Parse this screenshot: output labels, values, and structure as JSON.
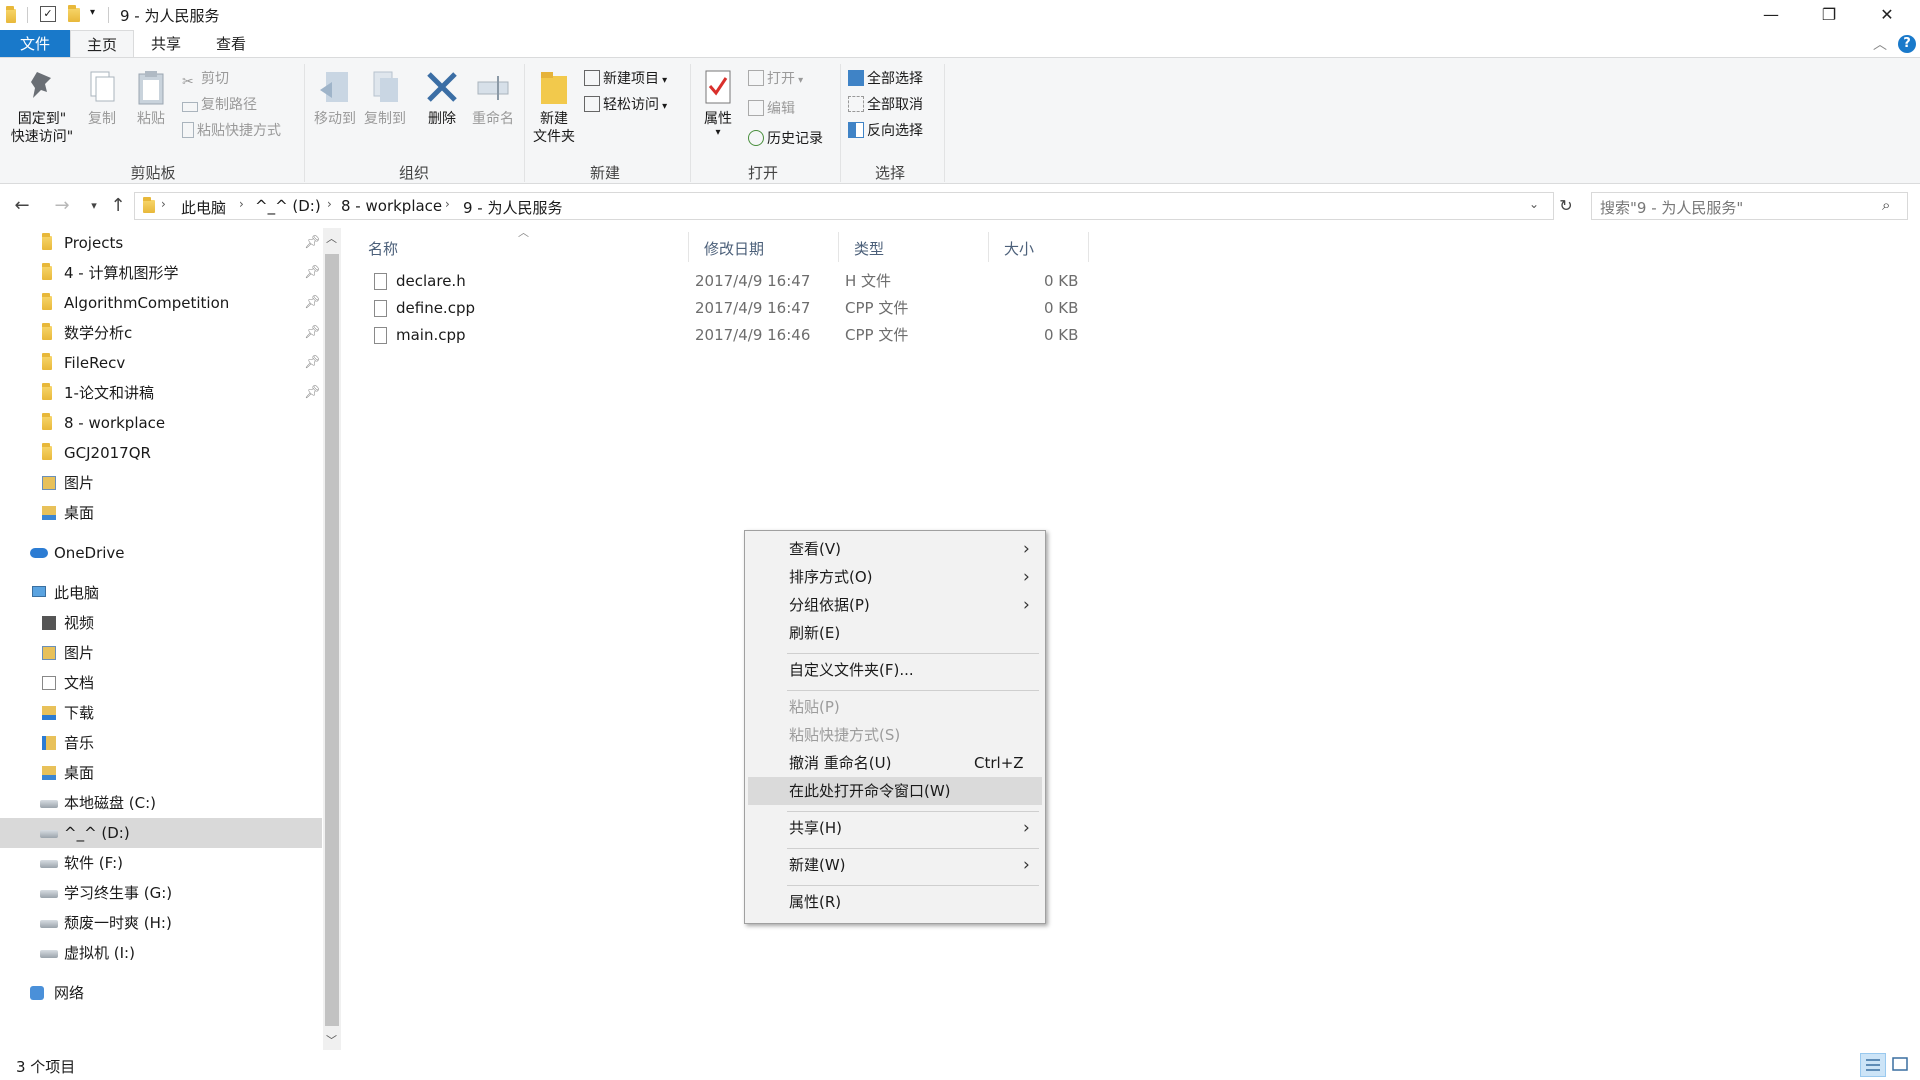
{
  "window": {
    "title": "9 - 为人民服务",
    "controls": {
      "minimize": "—",
      "maximize": "❐",
      "close": "✕"
    }
  },
  "ribbon": {
    "tabs": [
      {
        "label": "文件",
        "style": "file"
      },
      {
        "label": "主页",
        "style": "active"
      },
      {
        "label": "共享",
        "style": "normal"
      },
      {
        "label": "查看",
        "style": "normal"
      }
    ],
    "clipboard": {
      "group_label": "剪贴板",
      "pin_label_1": "固定到\"",
      "pin_label_2": "快速访问\"",
      "copy": "复制",
      "paste": "粘贴",
      "cut": "剪切",
      "copy_path": "复制路径",
      "paste_shortcut": "粘贴快捷方式"
    },
    "organize": {
      "group_label": "组织",
      "move_to": "移动到",
      "copy_to": "复制到",
      "delete": "删除",
      "rename": "重命名"
    },
    "new": {
      "group_label": "新建",
      "new_folder_1": "新建",
      "new_folder_2": "文件夹",
      "new_item": "新建项目",
      "easy_access": "轻松访问"
    },
    "open": {
      "group_label": "打开",
      "properties": "属性",
      "open": "打开",
      "edit": "编辑",
      "history": "历史记录"
    },
    "select": {
      "group_label": "选择",
      "select_all": "全部选择",
      "select_none": "全部取消",
      "invert": "反向选择"
    }
  },
  "address": {
    "crumbs": [
      "此电脑",
      "^_^ (D:)",
      "8 - workplace",
      "9 - 为人民服务"
    ],
    "search_placeholder": "搜索\"9 - 为人民服务\""
  },
  "nav": {
    "quick_access": [
      {
        "label": "Projects",
        "pinned": true
      },
      {
        "label": "4 - 计算机图形学",
        "pinned": true
      },
      {
        "label": "AlgorithmCompetition",
        "pinned": true
      },
      {
        "label": "数学分析c",
        "pinned": true
      },
      {
        "label": "FileRecv",
        "pinned": true
      },
      {
        "label": "1-论文和讲稿",
        "pinned": true
      },
      {
        "label": "8 - workplace",
        "pinned": false
      },
      {
        "label": "GCJ2017QR",
        "pinned": false
      },
      {
        "label": "图片",
        "pinned": false
      },
      {
        "label": "桌面",
        "pinned": false
      }
    ],
    "onedrive": "OneDrive",
    "this_pc": "此电脑",
    "pc_items": [
      "视频",
      "图片",
      "文档",
      "下载",
      "音乐",
      "桌面"
    ],
    "drives": [
      {
        "label": "本地磁盘 (C:)",
        "selected": false
      },
      {
        "label": "^_^ (D:)",
        "selected": true
      },
      {
        "label": "软件 (F:)",
        "selected": false
      },
      {
        "label": "学习终生事 (G:)",
        "selected": false
      },
      {
        "label": "颓废一时爽 (H:)",
        "selected": false
      },
      {
        "label": "虚拟机 (I:)",
        "selected": false
      }
    ],
    "network": "网络"
  },
  "filelist": {
    "columns": {
      "name": "名称",
      "date": "修改日期",
      "type": "类型",
      "size": "大小"
    },
    "files": [
      {
        "name": "declare.h",
        "date": "2017/4/9 16:47",
        "type": "H 文件",
        "size": "0 KB"
      },
      {
        "name": "define.cpp",
        "date": "2017/4/9 16:47",
        "type": "CPP 文件",
        "size": "0 KB"
      },
      {
        "name": "main.cpp",
        "date": "2017/4/9 16:46",
        "type": "CPP 文件",
        "size": "0 KB"
      }
    ]
  },
  "context_menu": {
    "items": [
      {
        "label": "查看(V)",
        "submenu": true
      },
      {
        "label": "排序方式(O)",
        "submenu": true
      },
      {
        "label": "分组依据(P)",
        "submenu": true
      },
      {
        "label": "刷新(E)"
      },
      {
        "separator": true
      },
      {
        "label": "自定义文件夹(F)..."
      },
      {
        "separator": true
      },
      {
        "label": "粘贴(P)",
        "disabled": true
      },
      {
        "label": "粘贴快捷方式(S)",
        "disabled": true
      },
      {
        "label": "撤消 重命名(U)",
        "shortcut": "Ctrl+Z"
      },
      {
        "label": "在此处打开命令窗口(W)",
        "hover": true
      },
      {
        "separator": true
      },
      {
        "label": "共享(H)",
        "submenu": true
      },
      {
        "separator": true
      },
      {
        "label": "新建(W)",
        "submenu": true
      },
      {
        "separator": true
      },
      {
        "label": "属性(R)"
      }
    ]
  },
  "status": {
    "item_count": "3 个项目"
  },
  "colors": {
    "accent": "#1979ca",
    "ribbon_bg": "#f5f6f7",
    "selection": "#d9d9d9",
    "menu_hover": "#dadada"
  }
}
